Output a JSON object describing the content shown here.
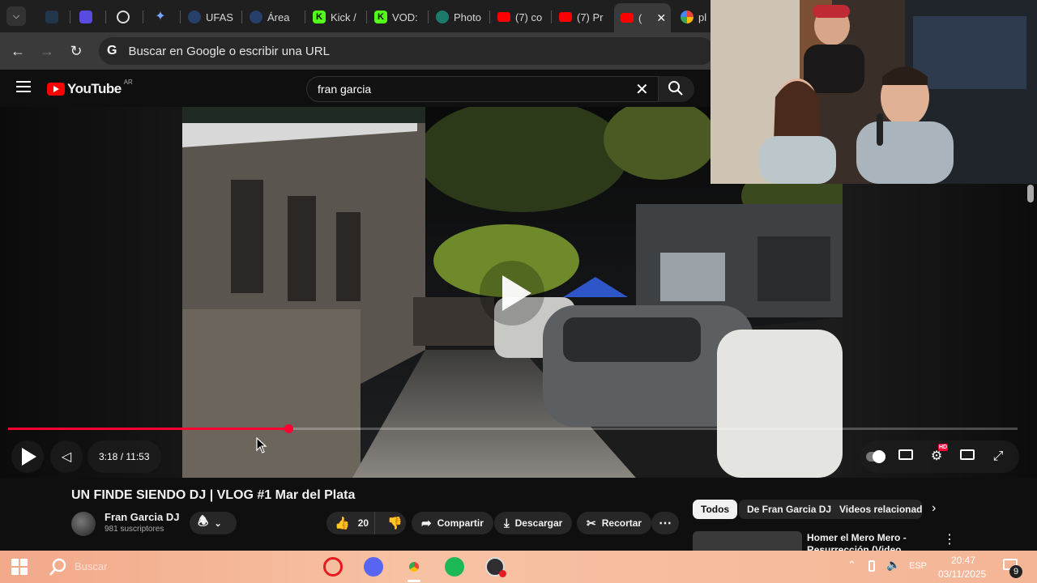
{
  "browser": {
    "tabs": [
      {
        "label": "",
        "icon": "folder-tab-icon",
        "active": false
      },
      {
        "label": "",
        "icon": "app-tab-icon",
        "active": false
      },
      {
        "label": "",
        "icon": "openai-icon",
        "active": false
      },
      {
        "label": "",
        "icon": "gemini-icon",
        "active": false
      },
      {
        "label": "UFAS",
        "icon": "ufasta-icon",
        "active": false
      },
      {
        "label": "Área",
        "icon": "area-icon",
        "active": false
      },
      {
        "label": "Kick /",
        "icon": "kick-icon",
        "active": false
      },
      {
        "label": "VOD:",
        "icon": "kick-icon",
        "active": false
      },
      {
        "label": "Photo",
        "icon": "photo-icon",
        "active": false
      },
      {
        "label": "(7) co",
        "icon": "youtube-icon",
        "active": false
      },
      {
        "label": "(7) Pr",
        "icon": "youtube-icon",
        "active": false
      },
      {
        "label": "(",
        "icon": "youtube-icon",
        "active": true
      },
      {
        "label": "pl",
        "icon": "google-icon",
        "active": false
      }
    ],
    "omnibox_placeholder": "Buscar en Google o escribir una URL",
    "omnibox_logo": "G"
  },
  "youtube": {
    "logo_text": "YouTube",
    "country": "AR",
    "search_value": "fran garcia"
  },
  "player": {
    "time_display": "3:18 / 11:53",
    "progress_fraction": 0.278,
    "hd_badge": "HD"
  },
  "video": {
    "title": "UN FINDE SIENDO DJ | VLOG #1 Mar del Plata",
    "channel": "Fran Garcia DJ",
    "subscribers": "981 suscriptores",
    "likes": "20",
    "share_label": "Compartir",
    "download_label": "Descargar",
    "clip_label": "Recortar"
  },
  "recommendations": {
    "chips": [
      "Todos",
      "De Fran Garcia DJ",
      "Videos relacionado"
    ],
    "first_item_title": "Homer el Mero Mero - Resurrección (Video Oficial)"
  },
  "taskbar": {
    "search_text": "Buscar",
    "language": "ESP",
    "time": "20:47",
    "date": "03/11/2025",
    "notification_count": "9"
  },
  "colors": {
    "youtube_red": "#ff0000",
    "progress_red": "#ff0033",
    "background": "#0f0f0f"
  }
}
